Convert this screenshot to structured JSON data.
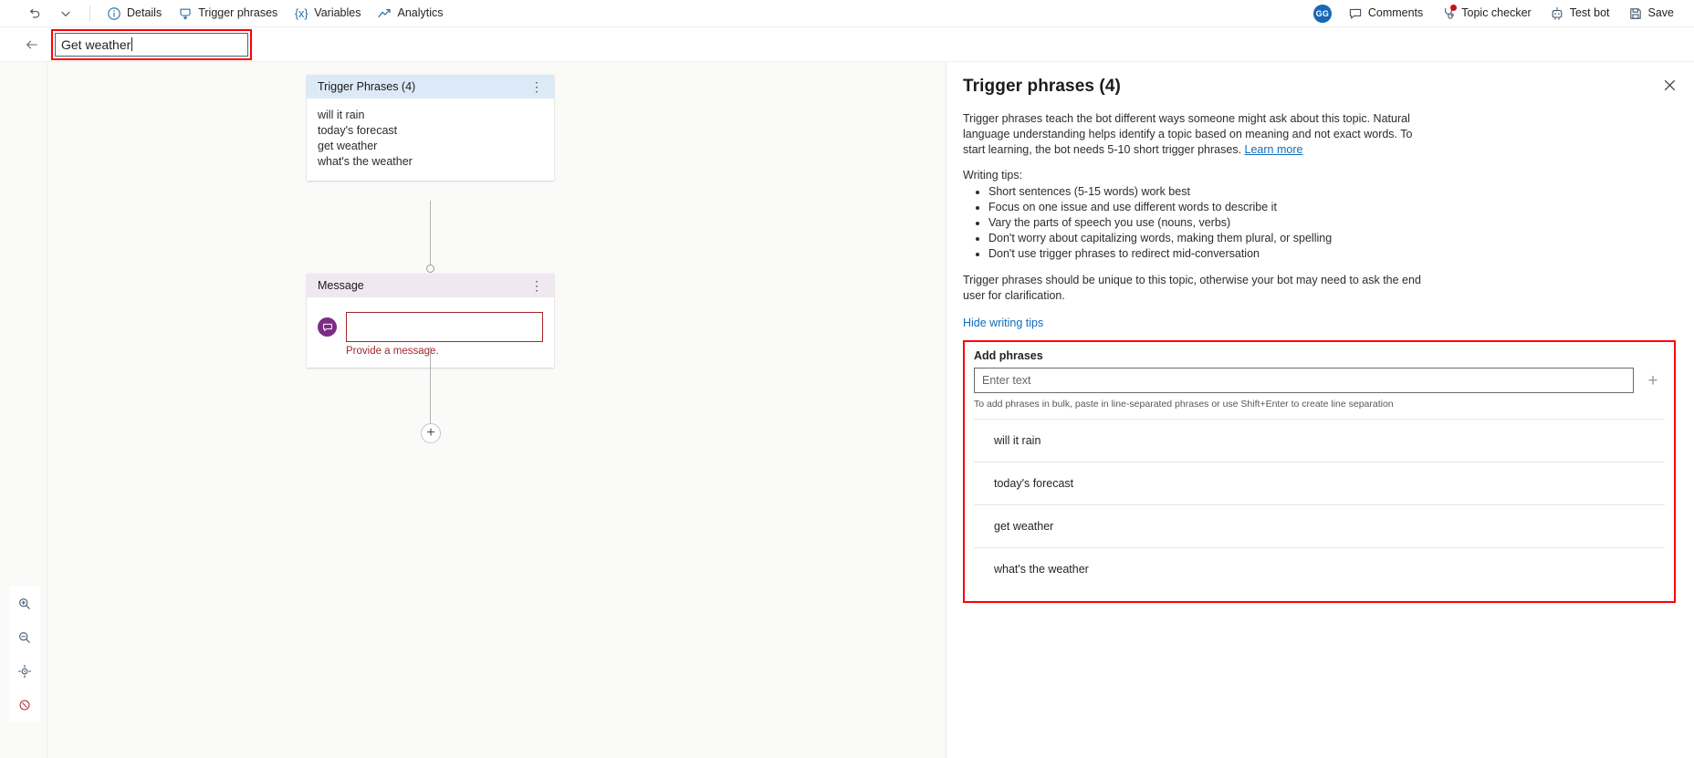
{
  "toolbar": {
    "undo_label": "",
    "caret_label": "",
    "items": [
      {
        "icon": "info-icon",
        "label": "Details"
      },
      {
        "icon": "trigger-icon",
        "label": "Trigger phrases"
      },
      {
        "icon": "variables-icon",
        "label": "Variables"
      },
      {
        "icon": "analytics-icon",
        "label": "Analytics"
      }
    ],
    "right_items": [
      {
        "icon": "comment-icon",
        "label": "Comments"
      },
      {
        "icon": "topic-checker-icon",
        "label": "Topic checker"
      },
      {
        "icon": "test-bot-icon",
        "label": "Test bot"
      },
      {
        "icon": "save-icon",
        "label": "Save"
      }
    ],
    "avatar_initials": "GG",
    "variables_glyph": "{x}"
  },
  "title_row": {
    "back_icon": "back-arrow-icon",
    "topic_name": "Get weather"
  },
  "canvas": {
    "trigger_node": {
      "header": "Trigger Phrases (4)",
      "menu_glyph": "⋮",
      "phrases": [
        "will it rain",
        "today's forecast",
        "get weather",
        "what's the weather"
      ]
    },
    "message_node": {
      "header": "Message",
      "menu_glyph": "⋮",
      "message_value": "",
      "error": "Provide a message."
    },
    "add_node_glyph": "+"
  },
  "zoom_tools": [
    {
      "name": "zoom-in-icon"
    },
    {
      "name": "zoom-out-icon"
    },
    {
      "name": "fit-to-screen-icon"
    },
    {
      "name": "reset-view-icon"
    }
  ],
  "panel": {
    "title": "Trigger phrases (4)",
    "close_icon": "close-icon",
    "description_part1": "Trigger phrases teach the bot different ways someone might ask about this topic. Natural language understanding helps identify a topic based on meaning and not exact words. To start learning, the bot needs 5-10 short trigger phrases. ",
    "learn_more": "Learn more",
    "tips_label": "Writing tips:",
    "tips": [
      "Short sentences (5-15 words) work best",
      "Focus on one issue and use different words to describe it",
      "Vary the parts of speech you use (nouns, verbs)",
      "Don't worry about capitalizing words, making them plural, or spelling",
      "Don't use trigger phrases to redirect mid-conversation"
    ],
    "unique_note": "Trigger phrases should be unique to this topic, otherwise your bot may need to ask the end user for clarification.",
    "hide_tips": "Hide writing tips",
    "add_phrases_label": "Add phrases",
    "input_placeholder": "Enter text",
    "input_value": "",
    "add_glyph": "+",
    "bulk_hint": "To add phrases in bulk, paste in line-separated phrases or use Shift+Enter to create line separation",
    "phrases": [
      "will it rain",
      "today's forecast",
      "get weather",
      "what's the weather"
    ]
  },
  "colors": {
    "accent_link": "#0f6cbd",
    "annotation_red": "#ff0000",
    "error_red": "#a4262c",
    "trigger_header": "#dceaf7",
    "message_header": "#f0e8f0",
    "message_icon": "#7c2d83",
    "avatar": "#1866b5"
  }
}
